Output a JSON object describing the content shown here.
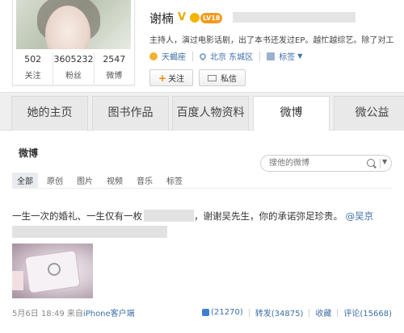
{
  "profile": {
    "name": "谢楠",
    "verified_mark": "V",
    "level": "LV18",
    "intro": "主持人，演过电影话剧，出了本书还发过EP。越忙越综艺。除了对工",
    "zodiac": "天蝎座",
    "location": "北京 东城区",
    "tags_label": "标签",
    "tags_caret": "▼",
    "follow_button": "关注",
    "message_button": "私信",
    "stats": [
      {
        "value": "502",
        "label": "关注"
      },
      {
        "value": "3605232",
        "label": "粉丝"
      },
      {
        "value": "2547",
        "label": "微博"
      }
    ]
  },
  "tabs": [
    {
      "label": "她的主页"
    },
    {
      "label": "图书作品"
    },
    {
      "label": "百度人物资料"
    },
    {
      "label": "微博",
      "active": true
    },
    {
      "label": "微公益"
    }
  ],
  "weibo": {
    "title": "微博",
    "search_placeholder": "搜他的微博",
    "search_caret": "▼",
    "filters": [
      "全部",
      "原创",
      "图片",
      "视频",
      "音乐",
      "标签"
    ],
    "post": {
      "text_part1": "一生一次的婚礼、一生仅有一枚",
      "text_part2": "，谢谢吴先生，你的承诺弥足珍贵。",
      "mention": "@吴京",
      "time": "5月6日 18:49",
      "source_prefix": "来自",
      "source_client": "iPhone客户端",
      "likes": "(21270)",
      "reposts": "转发(34875)",
      "favorite": "收藏",
      "comments": "评论(15668)"
    }
  },
  "colors": {
    "link": "#3e6ea8",
    "level_badge": "#f29a1c",
    "verified": "#e8a800",
    "tab_bg": "#e9e9e9"
  }
}
